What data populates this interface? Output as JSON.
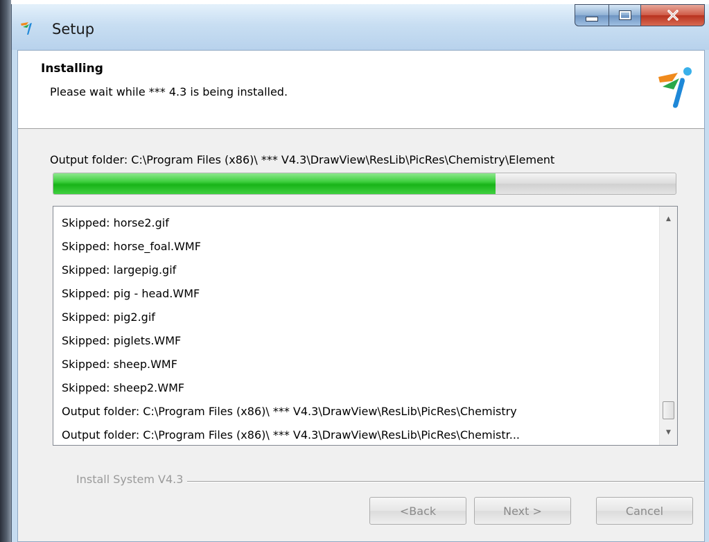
{
  "window": {
    "title": "Setup"
  },
  "header": {
    "title": "Installing",
    "subtitle": "Please wait while *** 4.3 is being installed."
  },
  "status": {
    "text": "Output folder: C:\\Program Files (x86)\\  ***  V4.3\\DrawView\\ResLib\\PicRes\\Chemistry\\Element"
  },
  "progress": {
    "fraction": 0.71
  },
  "log": {
    "items": [
      "Skipped: horse2.gif",
      "Skipped: horse_foal.WMF",
      "Skipped: largepig.gif",
      "Skipped: pig - head.WMF",
      "Skipped: pig2.gif",
      "Skipped: piglets.WMF",
      "Skipped: sheep.WMF",
      "Skipped: sheep2.WMF",
      "Output folder: C:\\Program Files (x86)\\  ***  V4.3\\DrawView\\ResLib\\PicRes\\Chemistry",
      "Output folder: C:\\Program Files (x86)\\  ***  V4.3\\DrawView\\ResLib\\PicRes\\Chemistr..."
    ]
  },
  "footer": {
    "branding": "Install System V4.3",
    "back_label": "<Back",
    "next_label": "Next >",
    "cancel_label": "Cancel"
  },
  "colors": {
    "progress_green": "#18b418",
    "titlebar_blue": "#c8def2",
    "close_red": "#cf5a46"
  },
  "icons": {
    "app": "setup-app-icon",
    "logo": "installer-logo-icon",
    "minimize": "minimize-icon",
    "maximize": "maximize-icon",
    "close": "close-icon"
  }
}
